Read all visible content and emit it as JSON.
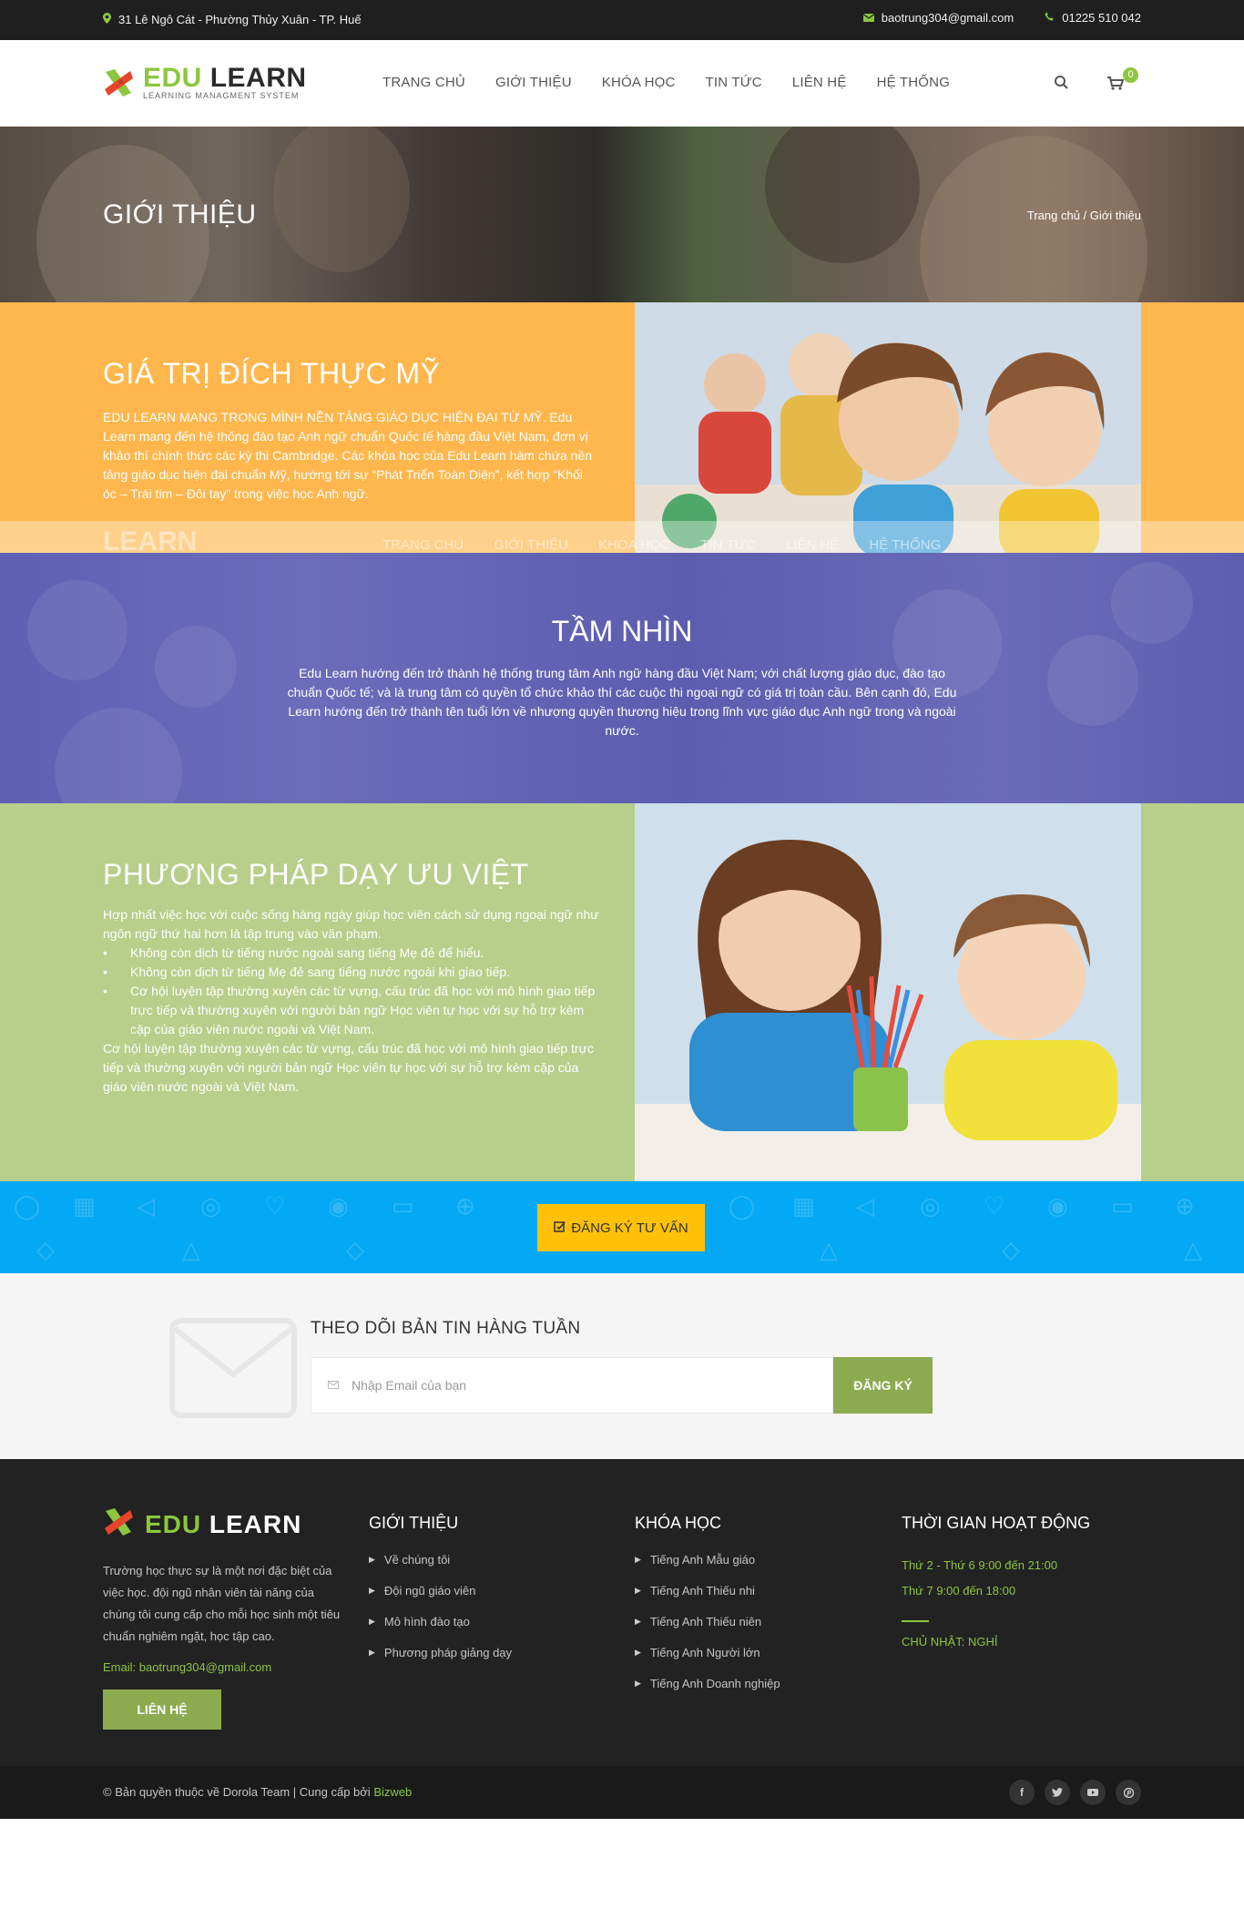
{
  "topbar": {
    "address": "31 Lê Ngô Cát - Phường Thủy Xuân - TP. Huế",
    "email": "baotrung304@gmail.com",
    "phone": "01225 510 042"
  },
  "brand": {
    "name_part1": "EDU",
    "name_part2": "LEARN",
    "tagline": "LEARNING MANAGMENT SYSTEM"
  },
  "nav": [
    "TRANG CHỦ",
    "GIỚI THIỆU",
    "KHÓA HỌC",
    "TIN TỨC",
    "LIÊN HỆ",
    "HỆ THỐNG"
  ],
  "cart_count": "0",
  "hero": {
    "title": "GIỚI THIỆU",
    "breadcrumb": "Trang chủ  /  Giới thiệu"
  },
  "section1": {
    "title": "GIÁ TRỊ ĐÍCH THỰC MỸ",
    "text": "EDU LEARN MANG TRONG MÌNH NỀN TẢNG GIÁO DỤC HIỆN ĐẠI TỪ MỸ. Edu Learn mang đến hệ thống đào tạo Anh ngữ chuẩn Quốc tế hàng đầu Việt Nam, đơn vị khảo thí chính thức các kỳ thi Cambridge. Các khóa học của Edu Learn hàm chứa nền tảng giáo dục hiện đại chuẩn Mỹ, hướng tới sự “Phát Triển Toàn Diện”, kết hợp “Khối óc – Trái tim – Đôi tay” trong việc học Anh ngữ."
  },
  "section2": {
    "title": "TẦM NHÌN",
    "text": "Edu Learn hướng đến trở thành hệ thống trung tâm Anh ngữ hàng đầu Việt Nam; với chất lượng giáo dục, đào tạo chuẩn Quốc tế; và là trung tâm có quyền tổ chức khảo thí các cuộc thi ngoại ngữ có giá trị toàn cầu. Bên cạnh đó, Edu Learn hướng đến trở thành tên tuổi lớn về nhượng quyền thương hiệu trong lĩnh vực giáo dục Anh ngữ trong và ngoài nước."
  },
  "section3": {
    "title": "PHƯƠNG PHÁP DẠY ƯU VIỆT",
    "intro": "Hợp nhất việc học với cuộc sống hàng ngày giúp học viên cách sử dụng ngoại ngữ như ngôn ngữ thứ hai hơn là tập trung vào văn phạm.",
    "bullets": [
      "Không còn dịch từ tiếng nước ngoài sang tiếng Mẹ đẻ để hiểu.",
      "Không còn dịch từ tiếng Mẹ đẻ sang tiếng nước ngoài khi giao tiếp.",
      "Cơ hội luyện tập thường xuyên các từ vựng, cấu trúc đã học với mô hình giao tiếp trực tiếp và thường xuyên với người bản ngữ Học viên tự học với sự hỗ trợ kèm cặp của giáo viên nước ngoài và Việt Nam."
    ],
    "outro": "Cơ hội luyện tập thường xuyên các từ vựng, cấu trúc đã học với mô hình giao tiếp trực tiếp và thường xuyên với người bản ngữ Học viên tự học với sự hỗ trợ kèm cặp của giáo viên nước ngoài và Việt Nam."
  },
  "cta": {
    "label": "ĐĂNG KÝ TƯ VẤN"
  },
  "newsletter": {
    "title": "THEO DÕI BẢN TIN HÀNG TUẦN",
    "placeholder": "Nhập Email của bạn",
    "button": "ĐĂNG KÝ"
  },
  "footer": {
    "description": "Trường học thực sự là một nơi đặc biệt của việc học. đội ngũ nhân viên tài năng của chúng tôi cung cấp cho mỗi học sinh một tiêu chuẩn nghiêm ngặt, học tập cao.",
    "email": "Email: baotrung304@gmail.com",
    "contact_button": "LIÊN HỆ",
    "col2_title": "GIỚI THIỆU",
    "col2_items": [
      "Về chúng tôi",
      "Đội ngũ giáo viên",
      "Mô hình đào tạo",
      "Phương pháp giảng dạy"
    ],
    "col3_title": "KHÓA HỌC",
    "col3_items": [
      "Tiếng Anh Mẫu giáo",
      "Tiếng Anh Thiếu nhi",
      "Tiếng Anh Thiếu niên",
      "Tiếng Anh Người lớn",
      "Tiếng Anh Doanh nghiệp"
    ],
    "col4_title": "THỜI GIAN HOẠT ĐỘNG",
    "hours1": "Thứ 2 - Thứ 6 9:00 đến 21:00",
    "hours2": "Thứ 7 9:00 đến 18:00",
    "closed": "CHỦ NHẬT: NGHỈ"
  },
  "bottom": {
    "copyright": "© Bản quyền thuộc về Dorola Team | Cung cấp bởi ",
    "provider": "Bizweb"
  },
  "colors": {
    "accent_green": "#8dc63f",
    "orange": "#ffb74d",
    "purple": "#5f60b3",
    "light_green": "#b7cf8b",
    "blue": "#03a9f4",
    "yellow": "#ffc107",
    "footer_bg": "#222222"
  },
  "icons": {
    "topbar": [
      "map-marker-icon",
      "envelope-icon",
      "phone-icon"
    ],
    "header": [
      "search-icon",
      "cart-icon"
    ],
    "socials": [
      "facebook-icon",
      "twitter-icon",
      "youtube-icon",
      "pinterest-icon"
    ]
  }
}
